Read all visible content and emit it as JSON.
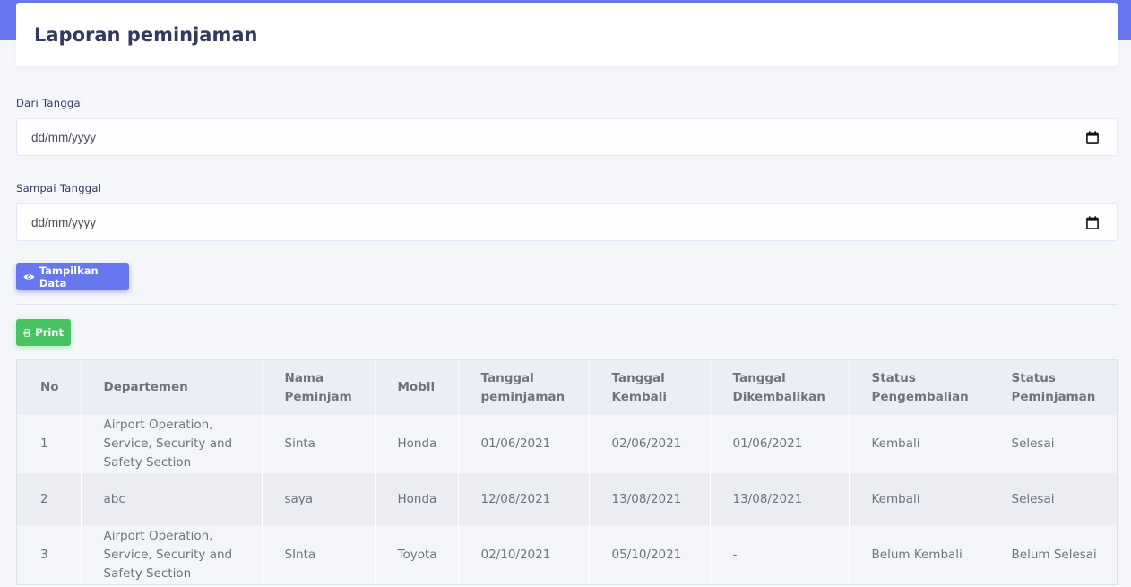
{
  "page": {
    "title": "Laporan peminjaman",
    "accent_color": "#6777ef"
  },
  "filter": {
    "from_label": "Dari Tanggal",
    "from_value": "dd/mm/yyyy",
    "to_label": "Sampai Tanggal",
    "to_value": "dd/mm/yyyy",
    "show_button_label": "Tampilkan Data",
    "show_button_icon": "eye-icon",
    "calendar_icon": "calendar-icon"
  },
  "actions": {
    "print_label": "Print",
    "print_icon": "printer-icon",
    "print_color": "#47c363"
  },
  "table": {
    "headers": [
      "No",
      "Departemen",
      "Nama Peminjam",
      "Mobil",
      "Tanggal peminjaman",
      "Tanggal Kembali",
      "Tanggal Dikembalikan",
      "Status Pengembalian",
      "Status Peminjaman"
    ],
    "rows": [
      [
        "1",
        "Airport Operation, Service, Security and Safety Section",
        "Sinta",
        "Honda",
        "01/06/2021",
        "02/06/2021",
        "01/06/2021",
        "Kembali",
        "Selesai"
      ],
      [
        "2",
        "abc",
        "saya",
        "Honda",
        "12/08/2021",
        "13/08/2021",
        "13/08/2021",
        "Kembali",
        "Selesai"
      ],
      [
        "3",
        "Airport Operation, Service, Security and Safety Section",
        "SInta",
        "Toyota",
        "02/10/2021",
        "05/10/2021",
        "-",
        "Belum Kembali",
        "Belum Selesai"
      ]
    ]
  }
}
